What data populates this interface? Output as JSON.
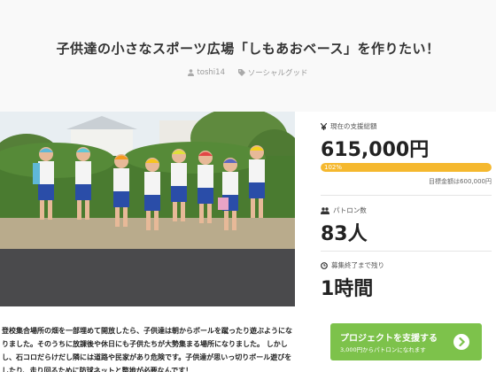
{
  "project": {
    "title": "子供達の小さなスポーツ広場「しもあおベース」を作りたい！",
    "author": "toshi14",
    "category": "ソーシャルグッド"
  },
  "icons": {
    "author": "user-icon",
    "category": "tag-icon",
    "amount": "yen-icon",
    "backers": "group-icon",
    "time": "clock-icon",
    "button": "chevron-right-circle-icon"
  },
  "stats": {
    "amount_label": "現在の支援総額",
    "amount_value": "615,000円",
    "progress_percent": 102,
    "progress_text": "102%",
    "goal_text": "目標金額は600,000円",
    "backers_label": "パトロン数",
    "backers_value": "83人",
    "time_label": "募集終了まで残り",
    "time_value": "1時間"
  },
  "support_button": {
    "label": "プロジェクトを支援する",
    "sublabel": "3,000円からパトロンになれます"
  },
  "description": {
    "line1": "登校集合場所の畑を一部埋めて開放したら、子供達は朝からボールを蹴ったり遊ぶようにな",
    "line2": "りました。そのうちに放課後や休日にも子供たちが大勢集まる場所になりました。 しかし",
    "line3": "し、石コロだらけだし隣には道路や民家があり危険です。子供達が思いっ切りボール遊びを",
    "line4": "したり、走り回るために防球ネットと整地が必要なんです！"
  },
  "colors": {
    "accent_green": "#7dc24b",
    "progress_yellow": "#f5b82e",
    "header_bg": "#f9f9f9"
  }
}
